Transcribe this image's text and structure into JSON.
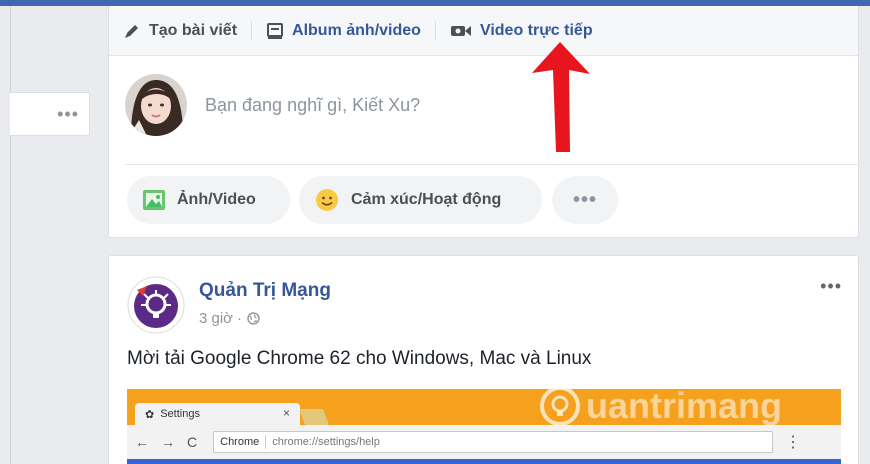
{
  "composer": {
    "tabs": {
      "create_post": "Tạo bài viết",
      "album": "Album ảnh/video",
      "live_video": "Video trực tiếp"
    },
    "placeholder": "Bạn đang nghĩ gì, Kiết Xu?",
    "actions": {
      "photo_video": "Ảnh/Video",
      "feeling_activity": "Cảm xúc/Hoạt động",
      "more": "•••"
    }
  },
  "left_panel": {
    "more": "•••"
  },
  "post": {
    "author": "Quản Trị Mạng",
    "time": "3 giờ",
    "separator": "·",
    "more": "•••",
    "text": "Mời tải Google Chrome 62 cho Windows, Mac và Linux",
    "image": {
      "tab_title": "Settings",
      "tab_close": "×",
      "site_chip": "Chrome",
      "url": "chrome://settings/help",
      "nav_back": "←",
      "nav_forward": "→",
      "nav_reload": "C",
      "menu": "⋮"
    }
  },
  "watermark": "uantrimang",
  "colors": {
    "facebook_blue": "#4267b2",
    "link_blue": "#365899",
    "annotation_red": "#e8141e",
    "chrome_orange": "#f6a11e"
  },
  "icons": {
    "create_post": "pencil-icon",
    "album": "album-icon",
    "live_video": "video-camera-icon",
    "photo": "photo-icon",
    "feeling": "smiley-icon",
    "privacy": "globe-icon",
    "annotation": "red-arrow"
  }
}
